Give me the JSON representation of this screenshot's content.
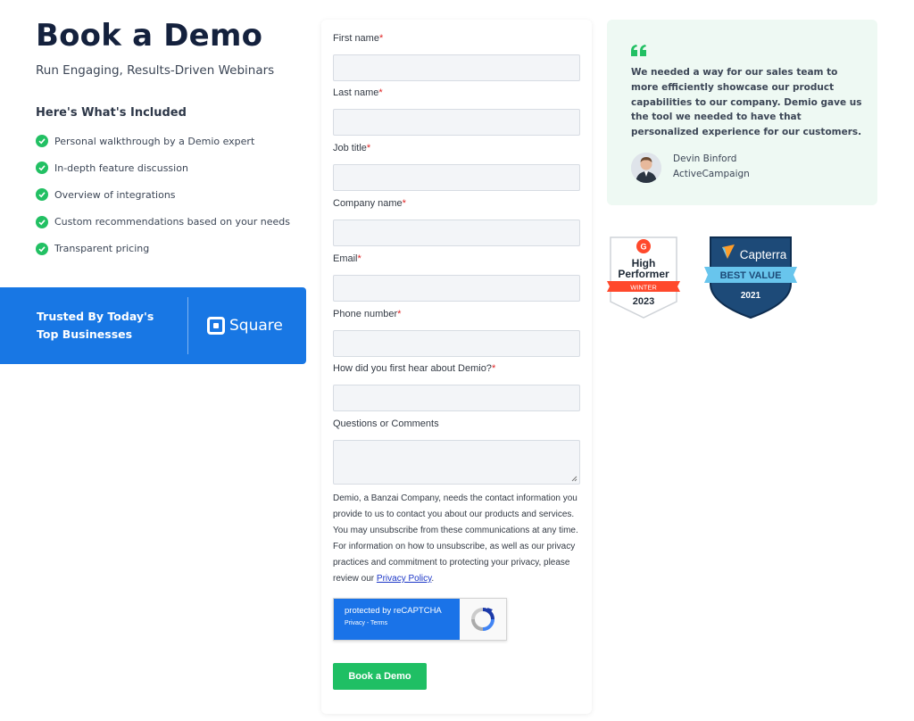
{
  "left": {
    "title": "Book a Demo",
    "subtitle": "Run Engaging, Results-Driven Webinars",
    "included_heading": "Here's What's Included",
    "features": [
      "Personal walkthrough by a Demio expert",
      "In-depth feature discussion",
      "Overview of integrations",
      "Custom recommendations based on your needs",
      "Transparent pricing"
    ],
    "trusted_line1": "Trusted By Today's",
    "trusted_line2": "Top Businesses",
    "partner_logo": "Square"
  },
  "form": {
    "fields": [
      {
        "label": "First name",
        "required": "*",
        "value": ""
      },
      {
        "label": "Last name",
        "required": "*",
        "value": ""
      },
      {
        "label": "Job title",
        "required": "*",
        "value": ""
      },
      {
        "label": "Company name",
        "required": "*",
        "value": ""
      },
      {
        "label": "Email",
        "required": "*",
        "value": ""
      },
      {
        "label": "Phone number",
        "required": "*",
        "value": ""
      },
      {
        "label": "How did you first hear about Demio?",
        "required": "*",
        "value": ""
      }
    ],
    "comments_label": "Questions or Comments",
    "disclaimer": "Demio, a Banzai Company, needs the contact information you provide to us to contact you about our products and services. You may unsubscribe from these communications at any time. For information on how to unsubscribe, as well as our privacy practices and commitment to protecting your privacy, please review our ",
    "privacy_link": "Privacy Policy",
    "disclaimer_end": ".",
    "recaptcha_main": "protected by reCAPTCHA",
    "recaptcha_sub": "Privacy - Terms",
    "submit_label": "Book a Demo"
  },
  "testimonial": {
    "quote": "We needed a way for our sales team to more efficiently showcase our product capabilities to our company.  Demio gave us the tool we needed to have that personalized experience for our customers.",
    "author_name": "Devin Binford",
    "author_company": "ActiveCampaign"
  },
  "badges": {
    "g2_line1": "High",
    "g2_line2": "Performer",
    "g2_season": "WINTER",
    "g2_year": "2023",
    "capterra_brand": "Capterra",
    "capterra_award": "BEST VALUE",
    "capterra_year": "2021"
  },
  "colors": {
    "brand_blue": "#1877e4",
    "success_green": "#22c063",
    "button_green": "#1fbf64",
    "testimonial_bg": "#eef9f3",
    "required_red": "#e02424"
  }
}
